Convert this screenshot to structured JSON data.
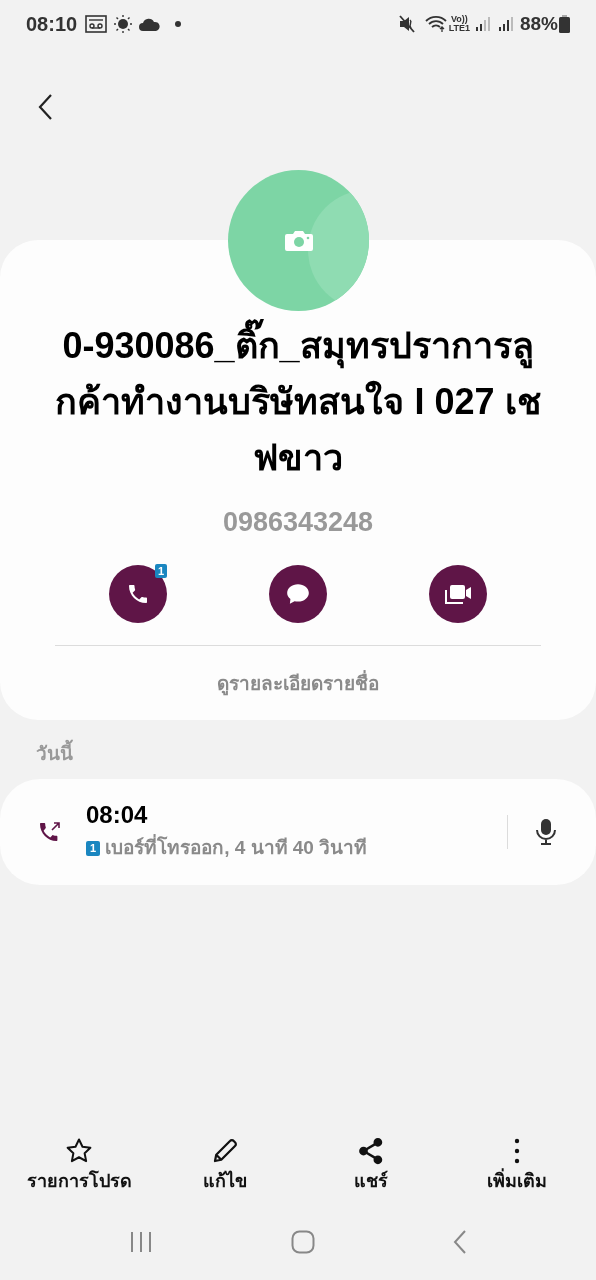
{
  "status_bar": {
    "time": "08:10",
    "network_top": "Vo))",
    "network_bottom": "LTE1",
    "battery": "88%"
  },
  "contact": {
    "name": "0-930086_ติ๊ก_สมุทรปราการลูกค้าทำงานบริษัทสนใจ I 027 เชฟขาว",
    "number": "0986343248",
    "actions": [
      {
        "kind": "call",
        "badge": "1"
      },
      {
        "kind": "message"
      },
      {
        "kind": "video"
      }
    ],
    "details_link": "ดูรายละเอียดรายชื่อ"
  },
  "history": {
    "section": "วันนี้",
    "entries": [
      {
        "time": "08:04",
        "sim": "1",
        "description": "เบอร์ที่โทรออก, 4 นาที 40 วินาที"
      }
    ]
  },
  "toolbar": [
    {
      "kind": "favorite",
      "label": "รายการโปรด"
    },
    {
      "kind": "edit",
      "label": "แก้ไข"
    },
    {
      "kind": "share",
      "label": "แชร์"
    },
    {
      "kind": "more",
      "label": "เพิ่มเติม"
    }
  ]
}
